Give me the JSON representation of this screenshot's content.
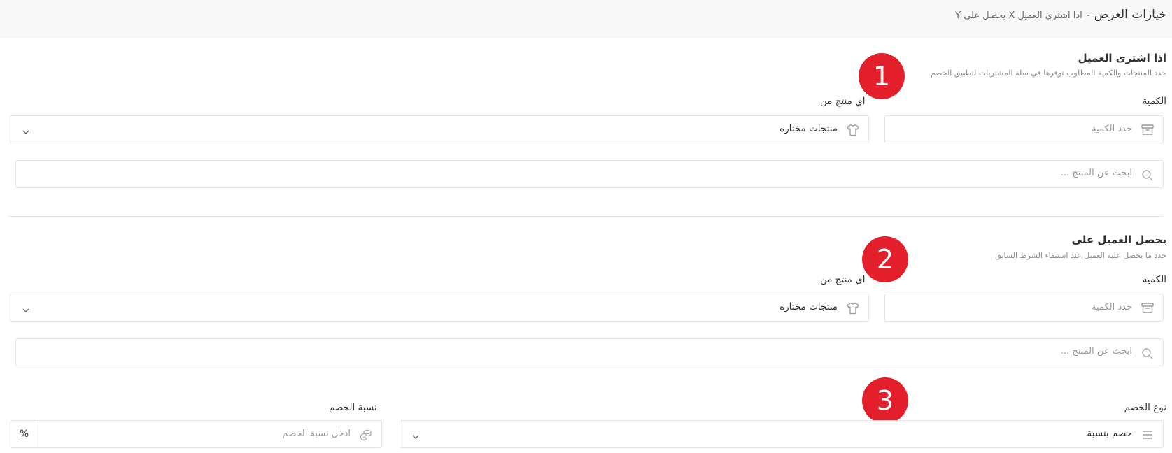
{
  "header": {
    "title": "خيارات العرض",
    "separator": "-",
    "subtitle": "اذا اشترى العميل X يحصل على Y"
  },
  "buy_section": {
    "badge": "1",
    "title": "اذا اشترى العميل",
    "description": "حدد المنتجات والكمية المطلوب توفرها في سلة المشتريات لتطبيق الخصم",
    "quantity_label": "الكمية",
    "quantity_placeholder": "حدد الكمية",
    "product_label": "اي منتج من",
    "product_value": "منتجات مختارة",
    "search_placeholder": "ابحث عن المنتج ..."
  },
  "get_section": {
    "badge": "2",
    "title": "يحصل العميل على",
    "description": "حدد ما يحصل عليه العميل عند استيفاء الشرط السابق",
    "quantity_label": "الكمية",
    "quantity_placeholder": "حدد الكمية",
    "product_label": "اي منتج من",
    "product_value": "منتجات مختارة",
    "search_placeholder": "ابحث عن المنتج ..."
  },
  "discount_section": {
    "badge": "3",
    "type_label": "نوع الخصم",
    "type_value": "خصم بنسبة",
    "rate_label": "نسبة الخصم",
    "rate_placeholder": "ادخل نسبة الخصم",
    "rate_unit": "%"
  },
  "icons": {
    "quantity": "box-icon",
    "product": "tshirt-icon",
    "search": "search-icon",
    "type": "list-icon",
    "rate": "coins-icon",
    "dropdown": "chevron-down-icon"
  },
  "colors": {
    "badge": "#e21f2a",
    "border": "#e4e4e4",
    "header_bg": "#f8f8f8"
  }
}
